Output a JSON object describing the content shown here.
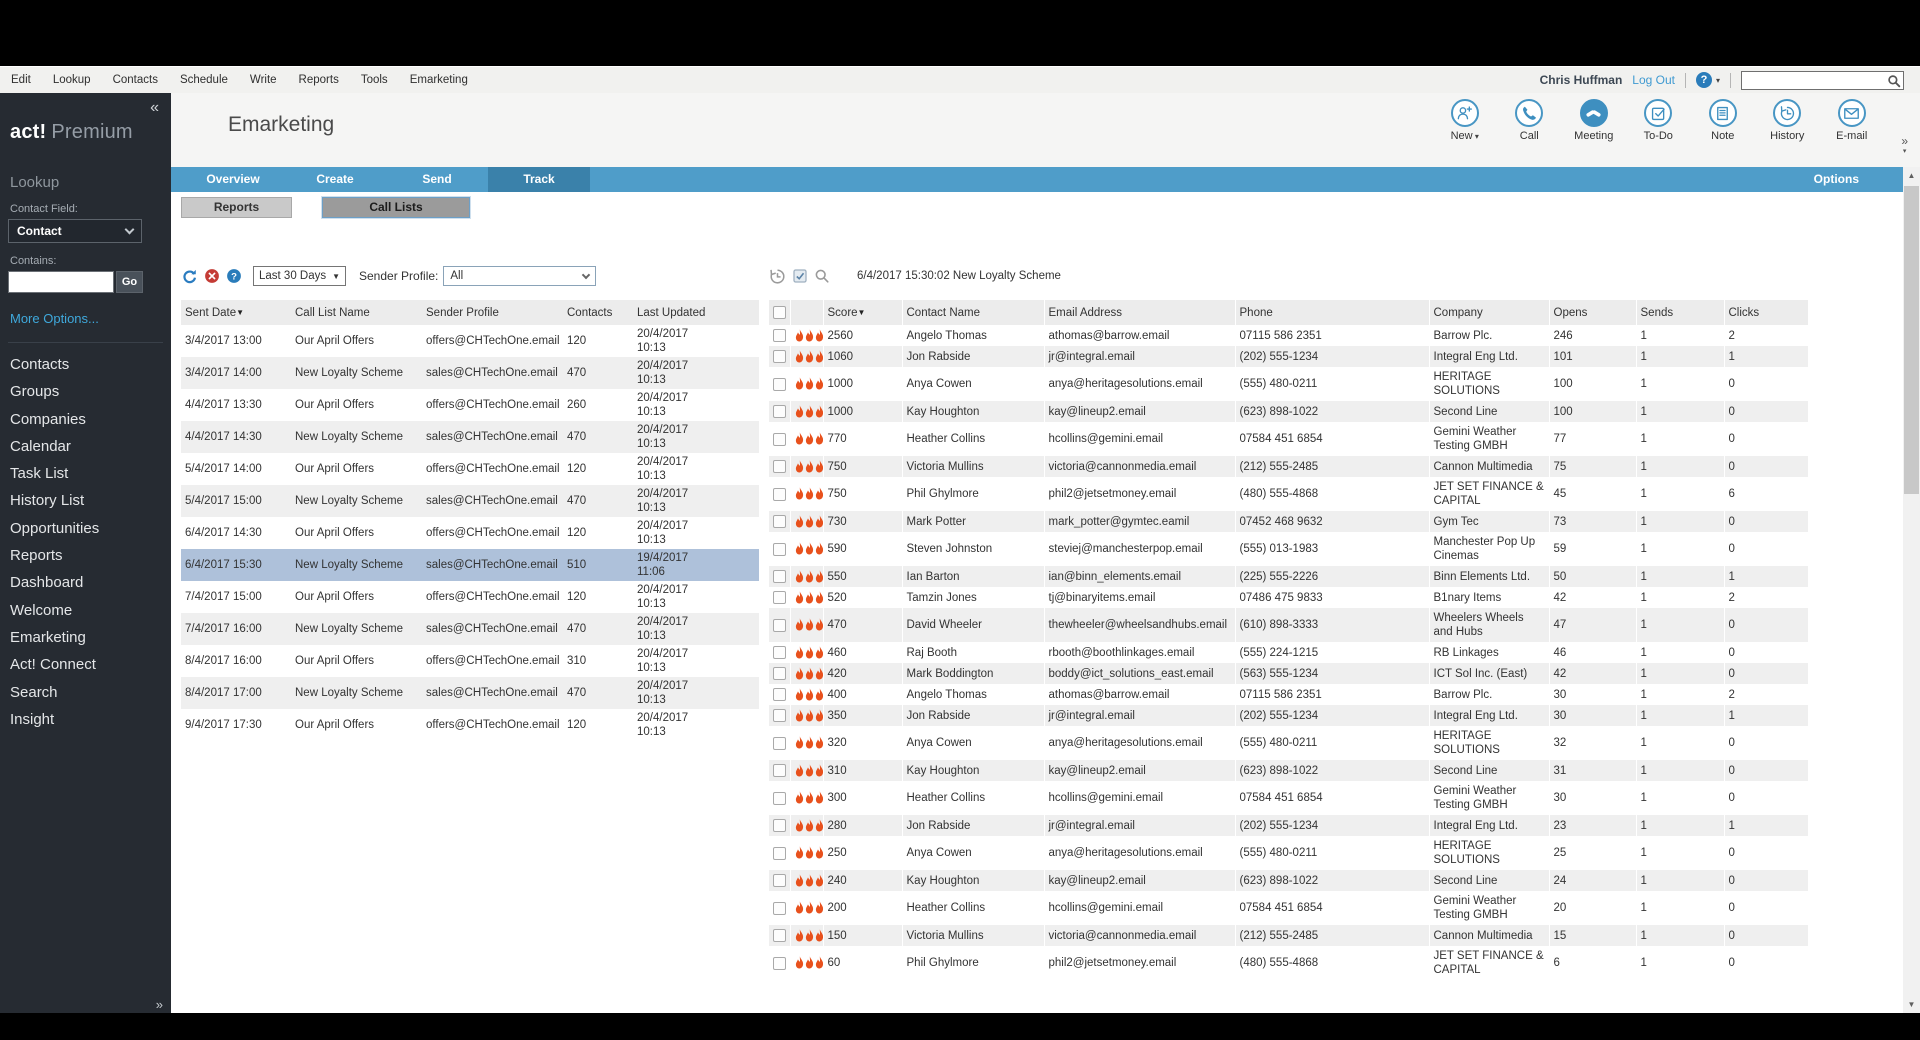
{
  "chrome": {
    "menu_items": [
      "Edit",
      "Lookup",
      "Contacts",
      "Schedule",
      "Write",
      "Reports",
      "Tools",
      "Emarketing"
    ],
    "user_name": "Chris Huffman",
    "logout_label": "Log Out",
    "help_glyph": "?",
    "search_value": ""
  },
  "sidebar": {
    "collapse_glyph": "«",
    "brand_bold": "act!",
    "brand_light": "Premium",
    "lookup_heading": "Lookup",
    "contact_field_label": "Contact Field:",
    "contact_field_value": "Contact",
    "contains_label": "Contains:",
    "contains_value": "",
    "go_label": "Go",
    "more_options_label": "More Options...",
    "nav_items": [
      "Contacts",
      "Groups",
      "Companies",
      "Calendar",
      "Task List",
      "History List",
      "Opportunities",
      "Reports",
      "Dashboard",
      "Welcome",
      "Emarketing",
      "Act! Connect",
      "Search",
      "Insight"
    ],
    "expander_glyph": "»"
  },
  "header": {
    "title": "Emarketing",
    "actions": [
      {
        "label": "New",
        "icon": "new-contact-icon",
        "dropdown": true
      },
      {
        "label": "Call",
        "icon": "call-icon"
      },
      {
        "label": "Meeting",
        "icon": "meeting-icon",
        "filled": true
      },
      {
        "label": "To-Do",
        "icon": "todo-icon"
      },
      {
        "label": "Note",
        "icon": "note-icon"
      },
      {
        "label": "History",
        "icon": "history-icon"
      },
      {
        "label": "E-mail",
        "icon": "email-icon"
      }
    ],
    "overflow_glyph": "»"
  },
  "tabs": {
    "items": [
      "Overview",
      "Create",
      "Send",
      "Track"
    ],
    "active_index": 3,
    "options_label": "Options"
  },
  "subtabs": {
    "items": [
      "Reports",
      "Call Lists"
    ],
    "active_index": 1
  },
  "call_lists_panel": {
    "date_range_value": "Last 30 Days",
    "sender_profile_label": "Sender Profile:",
    "sender_profile_value": "All",
    "columns": [
      "Sent Date",
      "Call List Name",
      "Sender Profile",
      "Contacts",
      "Last Updated"
    ],
    "sorted_column": "Sent Date",
    "selected_row_index": 7,
    "rows": [
      {
        "sent": "3/4/2017 13:00",
        "name": "Our April Offers",
        "profile": "offers@CHTechOne.email",
        "contacts": "120",
        "updated_date": "20/4/2017",
        "updated_time": "10:13"
      },
      {
        "sent": "3/4/2017 14:00",
        "name": "New Loyalty Scheme",
        "profile": "sales@CHTechOne.email",
        "contacts": "470",
        "updated_date": "20/4/2017",
        "updated_time": "10:13"
      },
      {
        "sent": "4/4/2017 13:30",
        "name": "Our April Offers",
        "profile": "offers@CHTechOne.email",
        "contacts": "260",
        "updated_date": "20/4/2017",
        "updated_time": "10:13"
      },
      {
        "sent": "4/4/2017 14:30",
        "name": "New Loyalty Scheme",
        "profile": "sales@CHTechOne.email",
        "contacts": "470",
        "updated_date": "20/4/2017",
        "updated_time": "10:13"
      },
      {
        "sent": "5/4/2017 14:00",
        "name": "Our April Offers",
        "profile": "offers@CHTechOne.email",
        "contacts": "120",
        "updated_date": "20/4/2017",
        "updated_time": "10:13"
      },
      {
        "sent": "5/4/2017 15:00",
        "name": "New Loyalty Scheme",
        "profile": "sales@CHTechOne.email",
        "contacts": "470",
        "updated_date": "20/4/2017",
        "updated_time": "10:13"
      },
      {
        "sent": "6/4/2017 14:30",
        "name": "Our April Offers",
        "profile": "offers@CHTechOne.email",
        "contacts": "120",
        "updated_date": "20/4/2017",
        "updated_time": "10:13"
      },
      {
        "sent": "6/4/2017 15:30",
        "name": "New Loyalty Scheme",
        "profile": "sales@CHTechOne.email",
        "contacts": "510",
        "updated_date": "19/4/2017",
        "updated_time": "11:06"
      },
      {
        "sent": "7/4/2017 15:00",
        "name": "Our April Offers",
        "profile": "offers@CHTechOne.email",
        "contacts": "120",
        "updated_date": "20/4/2017",
        "updated_time": "10:13"
      },
      {
        "sent": "7/4/2017 16:00",
        "name": "New Loyalty Scheme",
        "profile": "sales@CHTechOne.email",
        "contacts": "470",
        "updated_date": "20/4/2017",
        "updated_time": "10:13"
      },
      {
        "sent": "8/4/2017 16:00",
        "name": "Our April Offers",
        "profile": "offers@CHTechOne.email",
        "contacts": "310",
        "updated_date": "20/4/2017",
        "updated_time": "10:13"
      },
      {
        "sent": "8/4/2017 17:00",
        "name": "New Loyalty Scheme",
        "profile": "sales@CHTechOne.email",
        "contacts": "470",
        "updated_date": "20/4/2017",
        "updated_time": "10:13"
      },
      {
        "sent": "9/4/2017 17:30",
        "name": "Our April Offers",
        "profile": "offers@CHTechOne.email",
        "contacts": "120",
        "updated_date": "20/4/2017",
        "updated_time": "10:13"
      }
    ]
  },
  "detail_panel": {
    "title": "6/4/2017 15:30:02 New Loyalty Scheme",
    "columns": [
      "Score",
      "Contact Name",
      "Email Address",
      "Phone",
      "Company",
      "Opens",
      "Sends",
      "Clicks"
    ],
    "sorted_column": "Score",
    "flames_per_row": 3,
    "rows": [
      {
        "score": "2560",
        "name": "Angelo Thomas",
        "email": "athomas@barrow.email",
        "phone": "07115 586 2351",
        "company": "Barrow Plc.",
        "opens": "246",
        "sends": "1",
        "clicks": "2"
      },
      {
        "score": "1060",
        "name": "Jon Rabside",
        "email": "jr@integral.email",
        "phone": "(202) 555-1234",
        "company": "Integral Eng Ltd.",
        "opens": "101",
        "sends": "1",
        "clicks": "1"
      },
      {
        "score": "1000",
        "name": "Anya Cowen",
        "email": "anya@heritagesolutions.email",
        "phone": "(555) 480-0211",
        "company": "HERITAGE SOLUTIONS",
        "opens": "100",
        "sends": "1",
        "clicks": "0"
      },
      {
        "score": "1000",
        "name": "Kay Houghton",
        "email": "kay@lineup2.email",
        "phone": "(623) 898-1022",
        "company": "Second Line",
        "opens": "100",
        "sends": "1",
        "clicks": "0"
      },
      {
        "score": "770",
        "name": "Heather Collins",
        "email": "hcollins@gemini.email",
        "phone": "07584 451 6854",
        "company": "Gemini Weather Testing GMBH",
        "opens": "77",
        "sends": "1",
        "clicks": "0"
      },
      {
        "score": "750",
        "name": "Victoria Mullins",
        "email": "victoria@cannonmedia.email",
        "phone": "(212) 555-2485",
        "company": "Cannon Multimedia",
        "opens": "75",
        "sends": "1",
        "clicks": "0"
      },
      {
        "score": "750",
        "name": "Phil Ghylmore",
        "email": "phil2@jetsetmoney.email",
        "phone": "(480) 555-4868",
        "company": "JET SET FINANCE & CAPITAL",
        "opens": "45",
        "sends": "1",
        "clicks": "6"
      },
      {
        "score": "730",
        "name": "Mark Potter",
        "email": "mark_potter@gymtec.eamil",
        "phone": "07452 468 9632",
        "company": "Gym Tec",
        "opens": "73",
        "sends": "1",
        "clicks": "0"
      },
      {
        "score": "590",
        "name": "Steven Johnston",
        "email": "steviej@manchesterpop.email",
        "phone": "(555) 013-1983",
        "company": "Manchester Pop Up Cinemas",
        "opens": "59",
        "sends": "1",
        "clicks": "0"
      },
      {
        "score": "550",
        "name": "Ian Barton",
        "email": "ian@binn_elements.email",
        "phone": "(225) 555-2226",
        "company": "Binn Elements Ltd.",
        "opens": "50",
        "sends": "1",
        "clicks": "1"
      },
      {
        "score": "520",
        "name": "Tamzin Jones",
        "email": "tj@binaryitems.email",
        "phone": "07486 475 9833",
        "company": "B1nary Items",
        "opens": "42",
        "sends": "1",
        "clicks": "2"
      },
      {
        "score": "470",
        "name": "David Wheeler",
        "email": "thewheeler@wheelsandhubs.email",
        "phone": "(610) 898-3333",
        "company": "Wheelers Wheels and Hubs",
        "opens": "47",
        "sends": "1",
        "clicks": "0"
      },
      {
        "score": "460",
        "name": "Raj Booth",
        "email": "rbooth@boothlinkages.email",
        "phone": "(555) 224-1215",
        "company": "RB Linkages",
        "opens": "46",
        "sends": "1",
        "clicks": "0"
      },
      {
        "score": "420",
        "name": "Mark Boddington",
        "email": "boddy@ict_solutions_east.email",
        "phone": "(563) 555-1234",
        "company": "ICT Sol Inc. (East)",
        "opens": "42",
        "sends": "1",
        "clicks": "0"
      },
      {
        "score": "400",
        "name": "Angelo Thomas",
        "email": "athomas@barrow.email",
        "phone": "07115 586 2351",
        "company": "Barrow Plc.",
        "opens": "30",
        "sends": "1",
        "clicks": "2"
      },
      {
        "score": "350",
        "name": "Jon Rabside",
        "email": "jr@integral.email",
        "phone": "(202) 555-1234",
        "company": "Integral Eng Ltd.",
        "opens": "30",
        "sends": "1",
        "clicks": "1"
      },
      {
        "score": "320",
        "name": "Anya Cowen",
        "email": "anya@heritagesolutions.email",
        "phone": "(555) 480-0211",
        "company": "HERITAGE SOLUTIONS",
        "opens": "32",
        "sends": "1",
        "clicks": "0"
      },
      {
        "score": "310",
        "name": "Kay Houghton",
        "email": "kay@lineup2.email",
        "phone": "(623) 898-1022",
        "company": "Second Line",
        "opens": "31",
        "sends": "1",
        "clicks": "0"
      },
      {
        "score": "300",
        "name": "Heather Collins",
        "email": "hcollins@gemini.email",
        "phone": "07584 451 6854",
        "company": "Gemini Weather Testing GMBH",
        "opens": "30",
        "sends": "1",
        "clicks": "0"
      },
      {
        "score": "280",
        "name": "Jon Rabside",
        "email": "jr@integral.email",
        "phone": "(202) 555-1234",
        "company": "Integral Eng Ltd.",
        "opens": "23",
        "sends": "1",
        "clicks": "1"
      },
      {
        "score": "250",
        "name": "Anya Cowen",
        "email": "anya@heritagesolutions.email",
        "phone": "(555) 480-0211",
        "company": "HERITAGE SOLUTIONS",
        "opens": "25",
        "sends": "1",
        "clicks": "0"
      },
      {
        "score": "240",
        "name": "Kay Houghton",
        "email": "kay@lineup2.email",
        "phone": "(623) 898-1022",
        "company": "Second Line",
        "opens": "24",
        "sends": "1",
        "clicks": "0"
      },
      {
        "score": "200",
        "name": "Heather Collins",
        "email": "hcollins@gemini.email",
        "phone": "07584 451 6854",
        "company": "Gemini Weather Testing GMBH",
        "opens": "20",
        "sends": "1",
        "clicks": "0"
      },
      {
        "score": "150",
        "name": "Victoria Mullins",
        "email": "victoria@cannonmedia.email",
        "phone": "(212) 555-2485",
        "company": "Cannon Multimedia",
        "opens": "15",
        "sends": "1",
        "clicks": "0"
      },
      {
        "score": "60",
        "name": "Phil Ghylmore",
        "email": "phil2@jetsetmoney.email",
        "phone": "(480) 555-4868",
        "company": "JET SET FINANCE & CAPITAL",
        "opens": "6",
        "sends": "1",
        "clicks": "0"
      }
    ]
  },
  "colors": {
    "accent_blue": "#3e8fc0",
    "tab_bar": "#4f9dc9",
    "tab_active": "#3a81aa",
    "flame_orange": "#e8511d",
    "selected_row": "#aec1da",
    "link_blue": "#3f9ad1",
    "sidebar_bg": "#262b32",
    "delete_red": "#c43b35"
  }
}
